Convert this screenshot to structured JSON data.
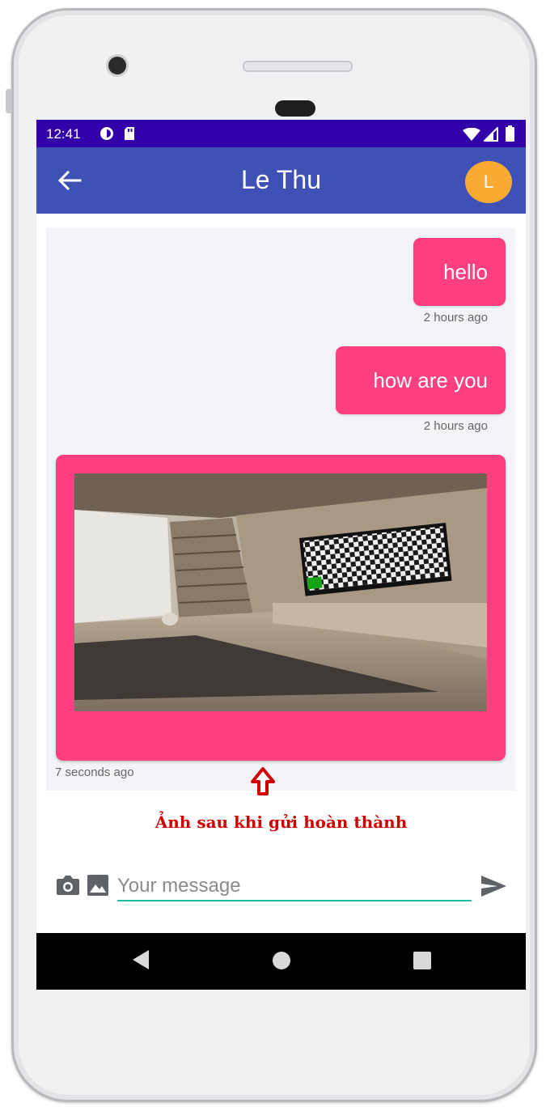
{
  "status_bar": {
    "time": "12:41"
  },
  "header": {
    "title": "Le Thu",
    "avatar_initial": "L"
  },
  "messages": [
    {
      "text": "hello",
      "time": "2 hours ago"
    },
    {
      "text": "how are you",
      "time": "2 hours ago"
    },
    {
      "type": "image",
      "time": "7 seconds ago"
    }
  ],
  "annotation": {
    "text": "Ảnh sau khi gửi hoàn thành"
  },
  "composer": {
    "placeholder": "Your message"
  },
  "colors": {
    "status_bar": "#3100a8",
    "app_bar": "#3f51b5",
    "bubble": "#ff3f7f",
    "avatar": "#f9aa33",
    "input_underline": "#1fbfa3"
  },
  "icons": {
    "back": "arrow-left-icon",
    "camera": "camera-icon",
    "gallery": "image-icon",
    "send": "send-icon"
  }
}
